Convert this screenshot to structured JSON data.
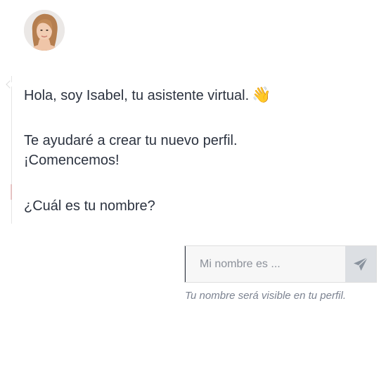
{
  "assistant": {
    "avatar_icon": "woman-avatar"
  },
  "messages": {
    "line1": "Hola, soy Isabel, tu asistente virtual.",
    "line1_emoji": "👋",
    "line2": "Te ayudaré a crear tu nuevo perfil.",
    "line3": "¡Comencemos!",
    "line4": "¿Cuál es tu nombre?"
  },
  "form": {
    "placeholder": "Mi nombre es ...",
    "send_icon": "send-icon",
    "hint": "Tu nombre será visible en tu perfil."
  },
  "colors": {
    "text": "#2c3340",
    "input_bg": "#f7f7f7",
    "send_bg": "#dcdfe3",
    "send_icon": "#8a939e",
    "hint": "#7c8391"
  }
}
